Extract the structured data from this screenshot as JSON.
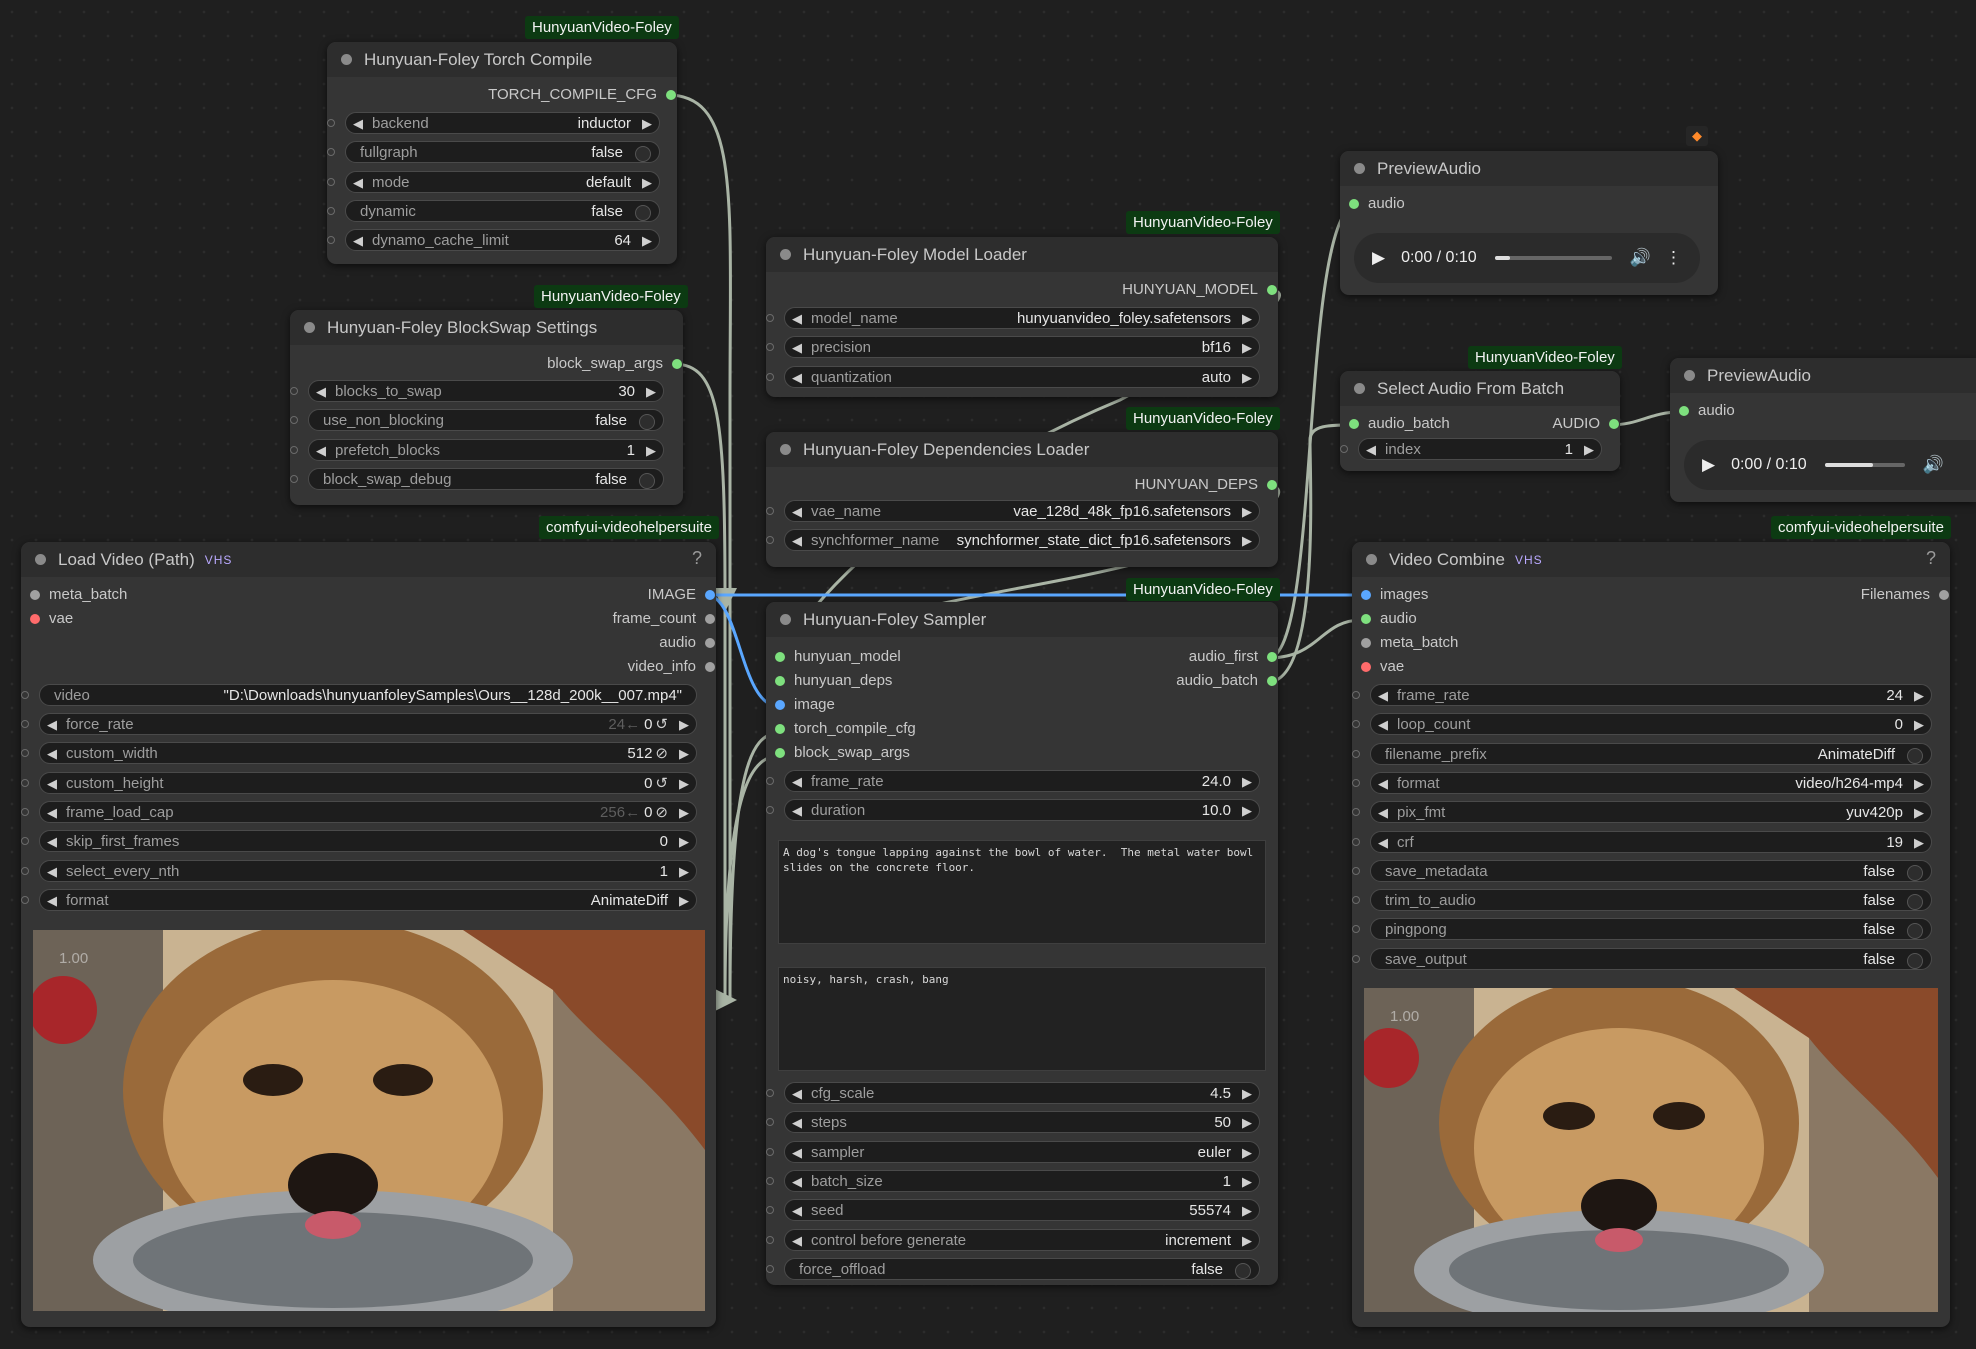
{
  "colors": {
    "green_port": "#7ee07e",
    "blue_port": "#5aa7ff",
    "red_port": "#ff6b6b",
    "gray_port": "#a0a0a0",
    "badge_bg": "#0c3a12",
    "wire": "#a9b4a5",
    "image_wire": "#5aa7ff"
  },
  "icons": {
    "node_dot": "circle",
    "arrow_left": "triangle-left",
    "arrow_right": "triangle-right",
    "reset": "reset-icon",
    "block": "block-icon",
    "play": "play-icon",
    "volume": "volume-icon",
    "more": "more-vertical-icon",
    "fox": "fox-icon"
  },
  "badges": {
    "torch": "HunyuanVideo-Foley",
    "block": "HunyuanVideo-Foley",
    "model": "HunyuanVideo-Foley",
    "deps": "HunyuanVideo-Foley",
    "sampler": "HunyuanVideo-Foley",
    "select": "HunyuanVideo-Foley",
    "vhs1": "comfyui-videohelpersuite",
    "vhs2": "comfyui-videohelpersuite"
  },
  "torch_compile": {
    "title": "Hunyuan-Foley Torch Compile",
    "output": "TORCH_COMPILE_CFG",
    "widgets": [
      {
        "label": "backend",
        "value": "inductor"
      },
      {
        "label": "fullgraph",
        "value": "false"
      },
      {
        "label": "mode",
        "value": "default"
      },
      {
        "label": "dynamic",
        "value": "false"
      },
      {
        "label": "dynamo_cache_limit",
        "value": "64"
      }
    ]
  },
  "blockswap": {
    "title": "Hunyuan-Foley BlockSwap Settings",
    "output": "block_swap_args",
    "widgets": [
      {
        "label": "blocks_to_swap",
        "value": "30"
      },
      {
        "label": "use_non_blocking",
        "value": "false"
      },
      {
        "label": "prefetch_blocks",
        "value": "1"
      },
      {
        "label": "block_swap_debug",
        "value": "false"
      }
    ]
  },
  "model_loader": {
    "title": "Hunyuan-Foley Model Loader",
    "output": "HUNYUAN_MODEL",
    "widgets": [
      {
        "label": "model_name",
        "value": "hunyuanvideo_foley.safetensors"
      },
      {
        "label": "precision",
        "value": "bf16"
      },
      {
        "label": "quantization",
        "value": "auto"
      }
    ]
  },
  "deps_loader": {
    "title": "Hunyuan-Foley Dependencies Loader",
    "output": "HUNYUAN_DEPS",
    "widgets": [
      {
        "label": "vae_name",
        "value": "vae_128d_48k_fp16.safetensors"
      },
      {
        "label": "synchformer_name",
        "value": "synchformer_state_dict_fp16.safetensors"
      }
    ]
  },
  "load_video": {
    "title": "Load Video (Path)",
    "vhs": "VHS",
    "help": "?",
    "inputs": [
      "meta_batch",
      "vae"
    ],
    "outputs": [
      "IMAGE",
      "frame_count",
      "audio",
      "video_info"
    ],
    "video": {
      "label": "video",
      "value": "\"D:\\Downloads\\hunyuanfoleySamples\\Ours__128d_200k__007.mp4\""
    },
    "widgets": [
      {
        "label": "force_rate",
        "muted": "24←",
        "value": "0",
        "icon": "↺"
      },
      {
        "label": "custom_width",
        "muted": "",
        "value": "512",
        "icon": "⊘"
      },
      {
        "label": "custom_height",
        "muted": "",
        "value": "0",
        "icon": "↺"
      },
      {
        "label": "frame_load_cap",
        "muted": "256←",
        "value": "0",
        "icon": "⊘"
      },
      {
        "label": "skip_first_frames",
        "muted": "",
        "value": "0",
        "icon": ""
      },
      {
        "label": "select_every_nth",
        "muted": "",
        "value": "1",
        "icon": ""
      },
      {
        "label": "format",
        "muted": "",
        "value": "AnimateDiff",
        "icon": ""
      }
    ],
    "scale": "1.00"
  },
  "sampler": {
    "title": "Hunyuan-Foley Sampler",
    "inputs": [
      "hunyuan_model",
      "hunyuan_deps",
      "image",
      "torch_compile_cfg",
      "block_swap_args"
    ],
    "outputs": [
      "audio_first",
      "audio_batch"
    ],
    "widgets_top": [
      {
        "label": "frame_rate",
        "value": "24.0"
      },
      {
        "label": "duration",
        "value": "10.0"
      }
    ],
    "prompt": "A dog's tongue lapping against the bowl of water.  The metal water bowl slides on the concrete floor.",
    "negative": "noisy, harsh, crash, bang",
    "widgets_bottom": [
      {
        "label": "cfg_scale",
        "value": "4.5"
      },
      {
        "label": "steps",
        "value": "50"
      },
      {
        "label": "sampler",
        "value": "euler"
      },
      {
        "label": "batch_size",
        "value": "1"
      },
      {
        "label": "seed",
        "value": "55574"
      },
      {
        "label": "control before generate",
        "value": "increment"
      },
      {
        "label": "force_offload",
        "value": "false"
      }
    ]
  },
  "preview_audio_1": {
    "title": "PreviewAudio",
    "input": "audio",
    "time": "0:00 / 0:10",
    "progress": 0.13
  },
  "preview_audio_2": {
    "title": "PreviewAudio",
    "input": "audio",
    "time": "0:00 / 0:10",
    "progress": 0.6
  },
  "select_audio": {
    "title": "Select Audio From Batch",
    "input": "audio_batch",
    "output": "AUDIO",
    "widgets": [
      {
        "label": "index",
        "value": "1"
      }
    ]
  },
  "video_combine": {
    "title": "Video Combine",
    "vhs": "VHS",
    "help": "?",
    "inputs": [
      "images",
      "audio",
      "meta_batch",
      "vae"
    ],
    "output": "Filenames",
    "widgets": [
      {
        "label": "frame_rate",
        "value": "24"
      },
      {
        "label": "loop_count",
        "value": "0"
      },
      {
        "label": "filename_prefix",
        "value": "AnimateDiff"
      },
      {
        "label": "format",
        "value": "video/h264-mp4"
      },
      {
        "label": "pix_fmt",
        "value": "yuv420p"
      },
      {
        "label": "crf",
        "value": "19"
      },
      {
        "label": "save_metadata",
        "value": "false"
      },
      {
        "label": "trim_to_audio",
        "value": "false"
      },
      {
        "label": "pingpong",
        "value": "false"
      },
      {
        "label": "save_output",
        "value": "false"
      }
    ],
    "scale": "1.00"
  }
}
